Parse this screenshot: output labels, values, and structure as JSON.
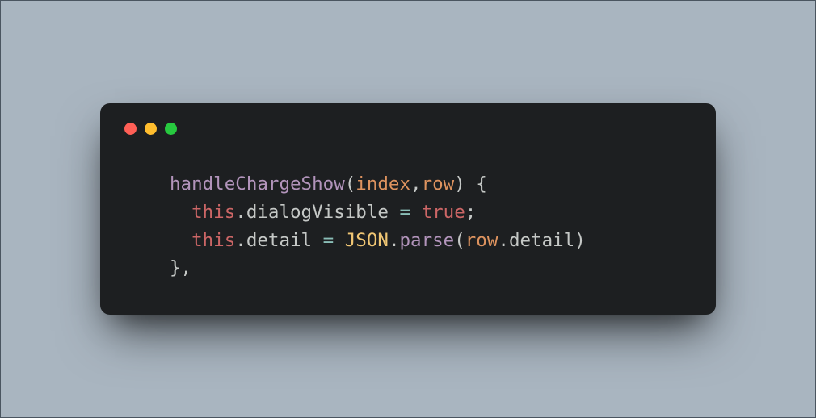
{
  "traffic_lights": {
    "close_color": "#ff5f56",
    "minimize_color": "#ffbd2e",
    "zoom_color": "#27c93f"
  },
  "code": {
    "indent1": "    ",
    "indent2": "      ",
    "line1": {
      "fn_name": "handleChargeShow",
      "open_paren": "(",
      "param1": "index",
      "comma1": ",",
      "param2": "row",
      "close_paren_brace": ") {"
    },
    "line2": {
      "this_kw": "this",
      "dot": ".",
      "prop": "dialogVisible",
      "sp1": " ",
      "op_eq": "=",
      "sp2": " ",
      "true_kw": "true",
      "semi": ";"
    },
    "line3": {
      "this_kw": "this",
      "dot1": ".",
      "prop": "detail",
      "sp1": " ",
      "op_eq": "=",
      "sp2": " ",
      "json_obj": "JSON",
      "dot2": ".",
      "parse_fn": "parse",
      "open_paren": "(",
      "row_id": "row",
      "dot3": ".",
      "detail_prop": "detail",
      "close_paren": ")"
    },
    "line4": {
      "close_brace_comma": "},"
    }
  }
}
